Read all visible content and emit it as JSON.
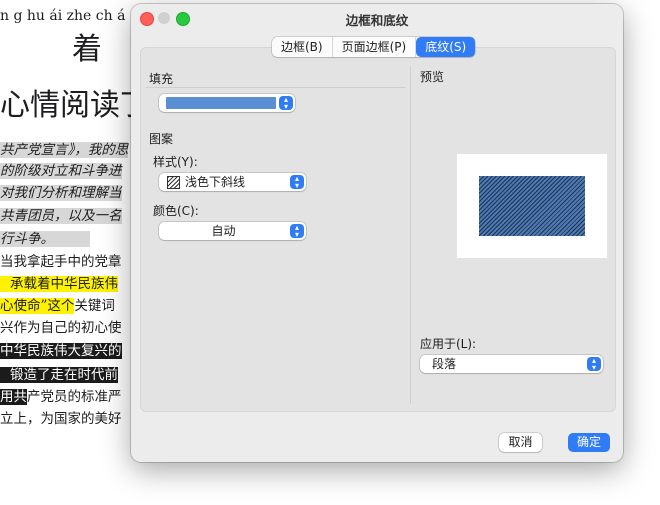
{
  "document": {
    "pinyin": "n g hu ái zhe ch á",
    "big_char": "着",
    "heading": "心情阅读丁",
    "lines": [
      "共产党宣言》，我的思",
      "的阶级对立和斗争进",
      "对我们分析和理解当",
      "共青团员，以及一名",
      "行斗争。",
      "当我拿起手中的党章",
      "承载着中华民族伟",
      "心使命”这个",
      "关键词",
      "兴作为自己的初心使",
      "中华民族伟大复兴的",
      "锻造了走在时代前",
      "用共",
      "产党员的标准严",
      "立上，为国家的美好"
    ]
  },
  "dialog": {
    "title": "边框和底纹",
    "tabs": [
      {
        "label": "边框(B)",
        "active": false
      },
      {
        "label": "页面边框(P)",
        "active": false
      },
      {
        "label": "底纹(S)",
        "active": true
      }
    ],
    "fill_label": "填充",
    "fill_color": "#5a8fd3",
    "pattern_label": "图案",
    "style_label": "样式(Y):",
    "style_value": "浅色下斜线",
    "color_label": "颜色(C):",
    "color_value": "自动",
    "preview_label": "预览",
    "apply_label": "应用于(L):",
    "apply_value": "段落",
    "cancel_label": "取消",
    "ok_label": "确定",
    "accent_color": "#2f7cf6"
  }
}
